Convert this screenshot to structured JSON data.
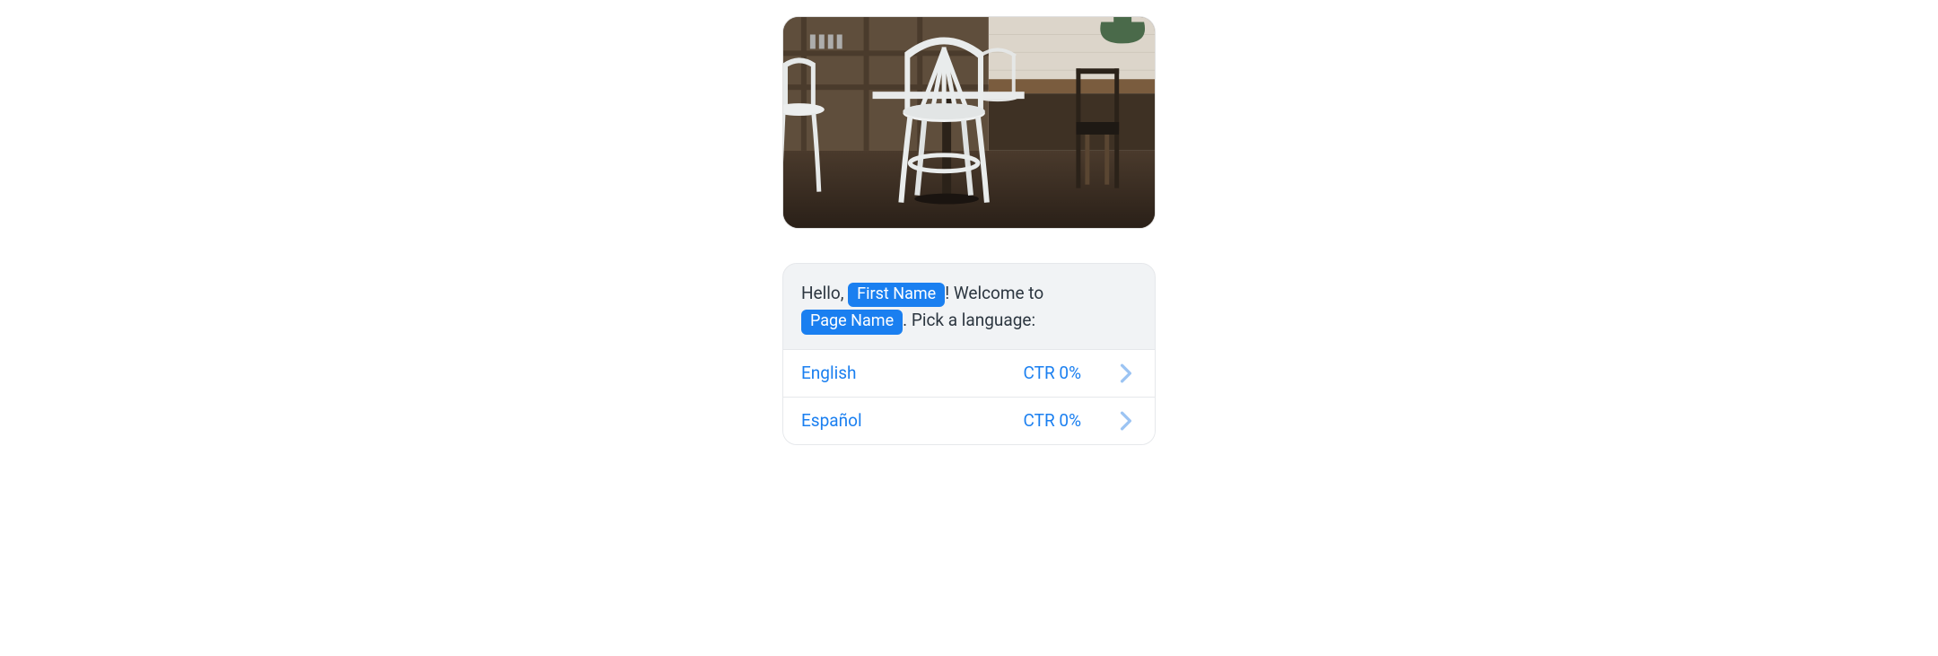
{
  "hero": {
    "alt": "cafe-chairs-photo"
  },
  "message": {
    "greeting_prefix": "Hello, ",
    "token_first_name": "First Name",
    "greeting_mid": "! Welcome to ",
    "token_page_name": "Page Name",
    "greeting_suffix": ". Pick a language:"
  },
  "options": [
    {
      "label": "English",
      "ctr": "CTR 0%"
    },
    {
      "label": "Español",
      "ctr": "CTR 0%"
    }
  ],
  "colors": {
    "accent": "#1a7ff0",
    "text": "#2c3640",
    "card_bg": "#f1f3f5",
    "border": "#e6e8eb"
  }
}
